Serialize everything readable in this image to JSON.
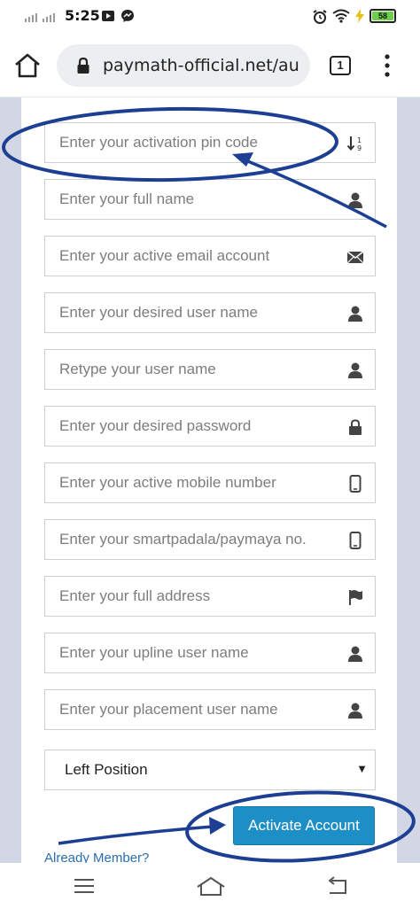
{
  "status_bar": {
    "time": "5:25",
    "battery": "58"
  },
  "browser": {
    "url": "paymath-official.net/au",
    "tab_count": "1"
  },
  "form": {
    "fields": [
      {
        "placeholder": "Enter your activation pin code",
        "icon": "sort-numeric-icon"
      },
      {
        "placeholder": "Enter your full name",
        "icon": "user-icon"
      },
      {
        "placeholder": "Enter your active email account",
        "icon": "envelope-icon"
      },
      {
        "placeholder": "Enter your desired user name",
        "icon": "user-icon"
      },
      {
        "placeholder": "Retype your user name",
        "icon": "user-icon"
      },
      {
        "placeholder": "Enter your desired password",
        "icon": "lock-icon"
      },
      {
        "placeholder": "Enter your active mobile number",
        "icon": "mobile-icon"
      },
      {
        "placeholder": "Enter your smartpadala/paymaya no.",
        "icon": "mobile-icon"
      },
      {
        "placeholder": "Enter your full address",
        "icon": "flag-icon"
      },
      {
        "placeholder": "Enter your upline user name",
        "icon": "user-icon"
      },
      {
        "placeholder": "Enter your placement user name",
        "icon": "user-icon"
      }
    ],
    "position_select": {
      "selected": "Left Position"
    },
    "activate_label": "Activate Account",
    "already_member_label": "Already Member?"
  },
  "colors": {
    "button": "#1e8fc6",
    "annotation": "#1c3f94",
    "page_bg": "#d3d6e4"
  }
}
